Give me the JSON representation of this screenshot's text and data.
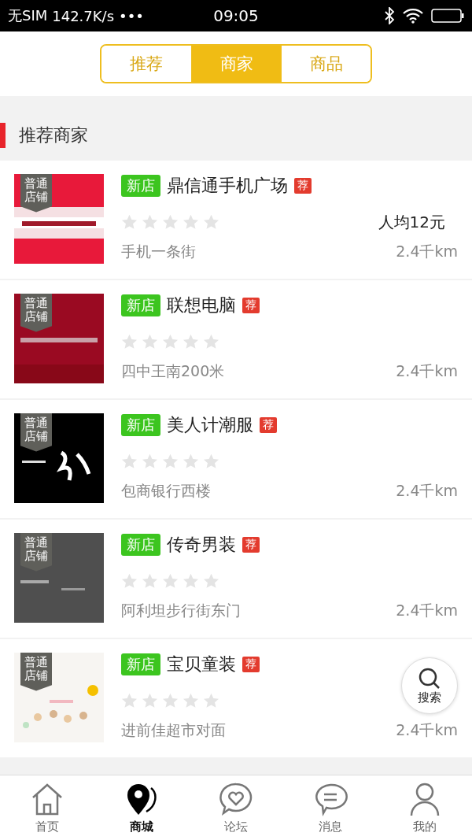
{
  "status_bar": {
    "carrier": "无SIM",
    "speed": "142.7K/s",
    "dots": "•••",
    "time": "09:05"
  },
  "tabs": [
    {
      "label": "推荐",
      "selected": false
    },
    {
      "label": "商家",
      "selected": true
    },
    {
      "label": "商品",
      "selected": false
    }
  ],
  "section_title": "推荐商家",
  "merchants": [
    {
      "ribbon": "普通店铺",
      "badge": "新店",
      "name": "鼎信通手机广场",
      "tag": "荐",
      "stars": 0,
      "average": "人均12元",
      "address": "手机一条街",
      "distance": "2.4千km"
    },
    {
      "ribbon": "普通店铺",
      "badge": "新店",
      "name": "联想电脑",
      "tag": "荐",
      "stars": 0,
      "address": "四中王南200米",
      "distance": "2.4千km"
    },
    {
      "ribbon": "普通店铺",
      "badge": "新店",
      "name": "美人计潮服",
      "tag": "荐",
      "stars": 0,
      "address": "包商银行西楼",
      "distance": "2.4千km"
    },
    {
      "ribbon": "普通店铺",
      "badge": "新店",
      "name": "传奇男装",
      "tag": "荐",
      "stars": 0,
      "address": "阿利坦步行街东门",
      "distance": "2.4千km"
    },
    {
      "ribbon": "普通店铺",
      "badge": "新店",
      "name": "宝贝童装",
      "tag": "荐",
      "stars": 0,
      "address": "进前佳超市对面",
      "distance": "2.4千km"
    }
  ],
  "search_button": {
    "label": "搜索"
  },
  "bottom_nav": [
    {
      "label": "首页",
      "selected": false
    },
    {
      "label": "商城",
      "selected": true
    },
    {
      "label": "论坛",
      "selected": false
    },
    {
      "label": "消息",
      "selected": false
    },
    {
      "label": "我的",
      "selected": false
    }
  ]
}
